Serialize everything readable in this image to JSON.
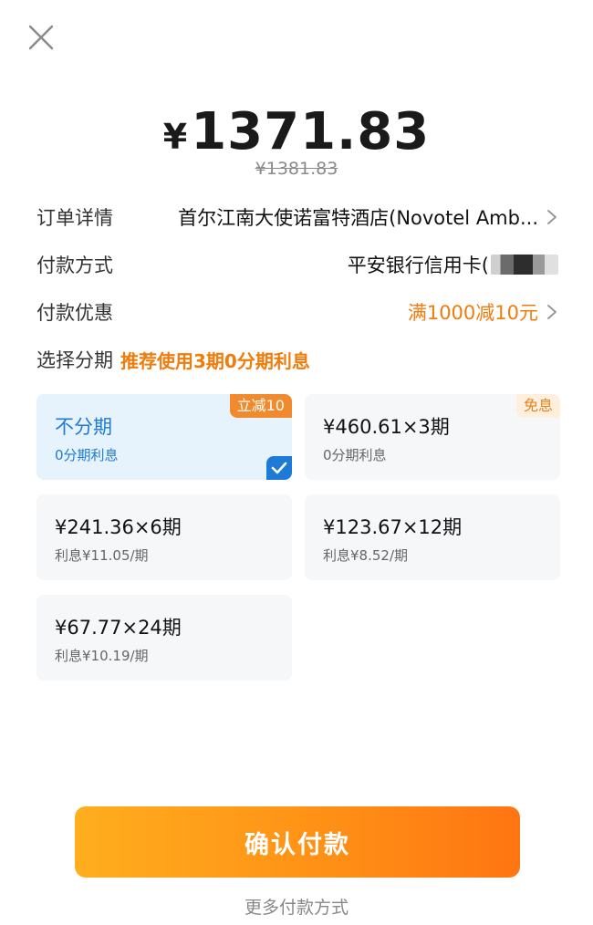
{
  "header": {
    "close_icon": "close-icon"
  },
  "price": {
    "currency": "¥",
    "amount": "1371.83",
    "original": "¥1381.83"
  },
  "order": {
    "label": "订单详情",
    "value": "首尔江南大使诺富特酒店(Novotel Amb..."
  },
  "payment_method": {
    "label": "付款方式",
    "value": "平安银行信用卡("
  },
  "discount": {
    "label": "付款优惠",
    "value": "满1000减10元"
  },
  "installment": {
    "label": "选择分期",
    "recommendation": "推荐使用3期0分期利息",
    "options": [
      {
        "title": "不分期",
        "sub": "0分期利息",
        "tag": "立减10",
        "selected": true
      },
      {
        "title": "¥460.61×3期",
        "sub": "0分期利息",
        "tag": "免息"
      },
      {
        "title": "¥241.36×6期",
        "sub": "利息¥11.05/期"
      },
      {
        "title": "¥123.67×12期",
        "sub": "利息¥8.52/期"
      },
      {
        "title": "¥67.77×24期",
        "sub": "利息¥10.19/期"
      }
    ]
  },
  "confirm_button": "确认付款",
  "more_methods": "更多付款方式",
  "colors": {
    "accent_orange": "#f07c0c",
    "selected_blue": "#1d7ad6",
    "button_start": "#ffae1e",
    "button_end": "#ff7512"
  }
}
